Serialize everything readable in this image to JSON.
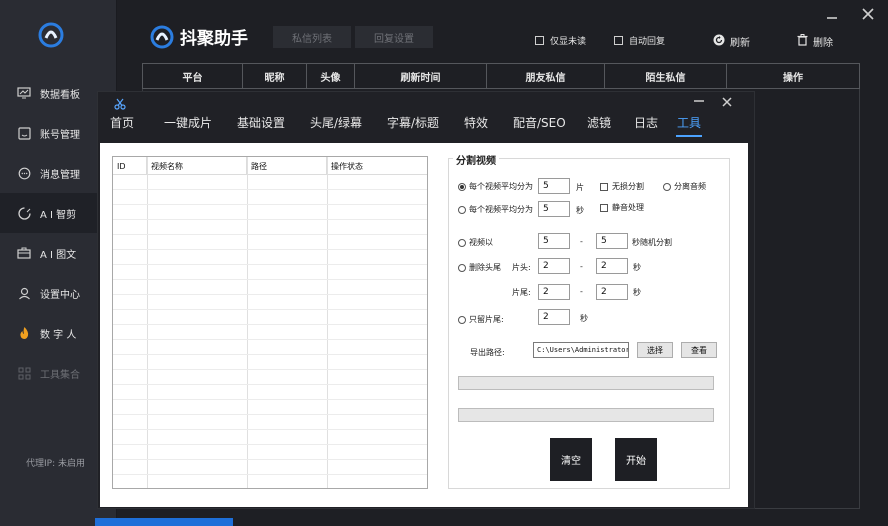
{
  "app": {
    "title": "抖聚助手"
  },
  "sidebar": {
    "items": [
      {
        "label": "数据看板",
        "icon": "monitor-icon"
      },
      {
        "label": "账号管理",
        "icon": "account-icon"
      },
      {
        "label": "消息管理",
        "icon": "message-icon"
      },
      {
        "label": "A I 智剪",
        "icon": "ai-cut-icon"
      },
      {
        "label": "A I 图文",
        "icon": "briefcase-icon"
      },
      {
        "label": "设置中心",
        "icon": "user-settings-icon"
      },
      {
        "label": "数 字 人",
        "icon": "flame-icon"
      },
      {
        "label": "工具集合",
        "icon": "grid-icon"
      }
    ],
    "proxy": "代理IP: 未启用"
  },
  "header": {
    "tab_private": "私信列表",
    "tab_reply": "回复设置",
    "only_unread": "仅显未读",
    "auto_reply": "自动回复",
    "refresh": "刷新",
    "delete": "删除"
  },
  "bg_table": {
    "columns": [
      "平台",
      "昵称",
      "头像",
      "刷新时间",
      "朋友私信",
      "陌生私信",
      "操作"
    ]
  },
  "modal": {
    "tabs": [
      "首页",
      "一键成片",
      "基础设置",
      "头尾/绿幕",
      "字幕/标题",
      "特效",
      "配音/SEO",
      "滤镜",
      "日志",
      "工具"
    ],
    "active_tab": "工具"
  },
  "list": {
    "columns": [
      "ID",
      "视频名称",
      "路径",
      "操作状态"
    ]
  },
  "split": {
    "title": "分割视频",
    "opt_avg_parts": "每个视频平均分为",
    "avg_parts_value": "5",
    "unit_piece": "片",
    "lossless": "无损分割",
    "separate_audio": "分离音频",
    "opt_avg_secs": "每个视频平均分为",
    "avg_secs_value": "5",
    "unit_sec": "秒",
    "mute": "静音处理",
    "opt_random": "视频以",
    "random_min": "5",
    "dash": "-",
    "random_max": "5",
    "random_suffix": "秒随机分割",
    "opt_trim": "删除头尾",
    "head_label": "片头:",
    "head_min": "2",
    "head_max": "2",
    "tail_label": "片尾:",
    "tail_min": "2",
    "tail_max": "2",
    "opt_keep_tail": "只留片尾:",
    "keep_tail_value": "2",
    "export_label": "导出路径:",
    "export_path": "C:\\Users\\Administrator\\",
    "choose": "选择",
    "view": "查看",
    "clear": "清空",
    "start": "开始"
  },
  "colors": {
    "accent": "#4ca3ff",
    "sidebar_bg": "#2a2c33",
    "dark_bg": "#1e1f24"
  }
}
